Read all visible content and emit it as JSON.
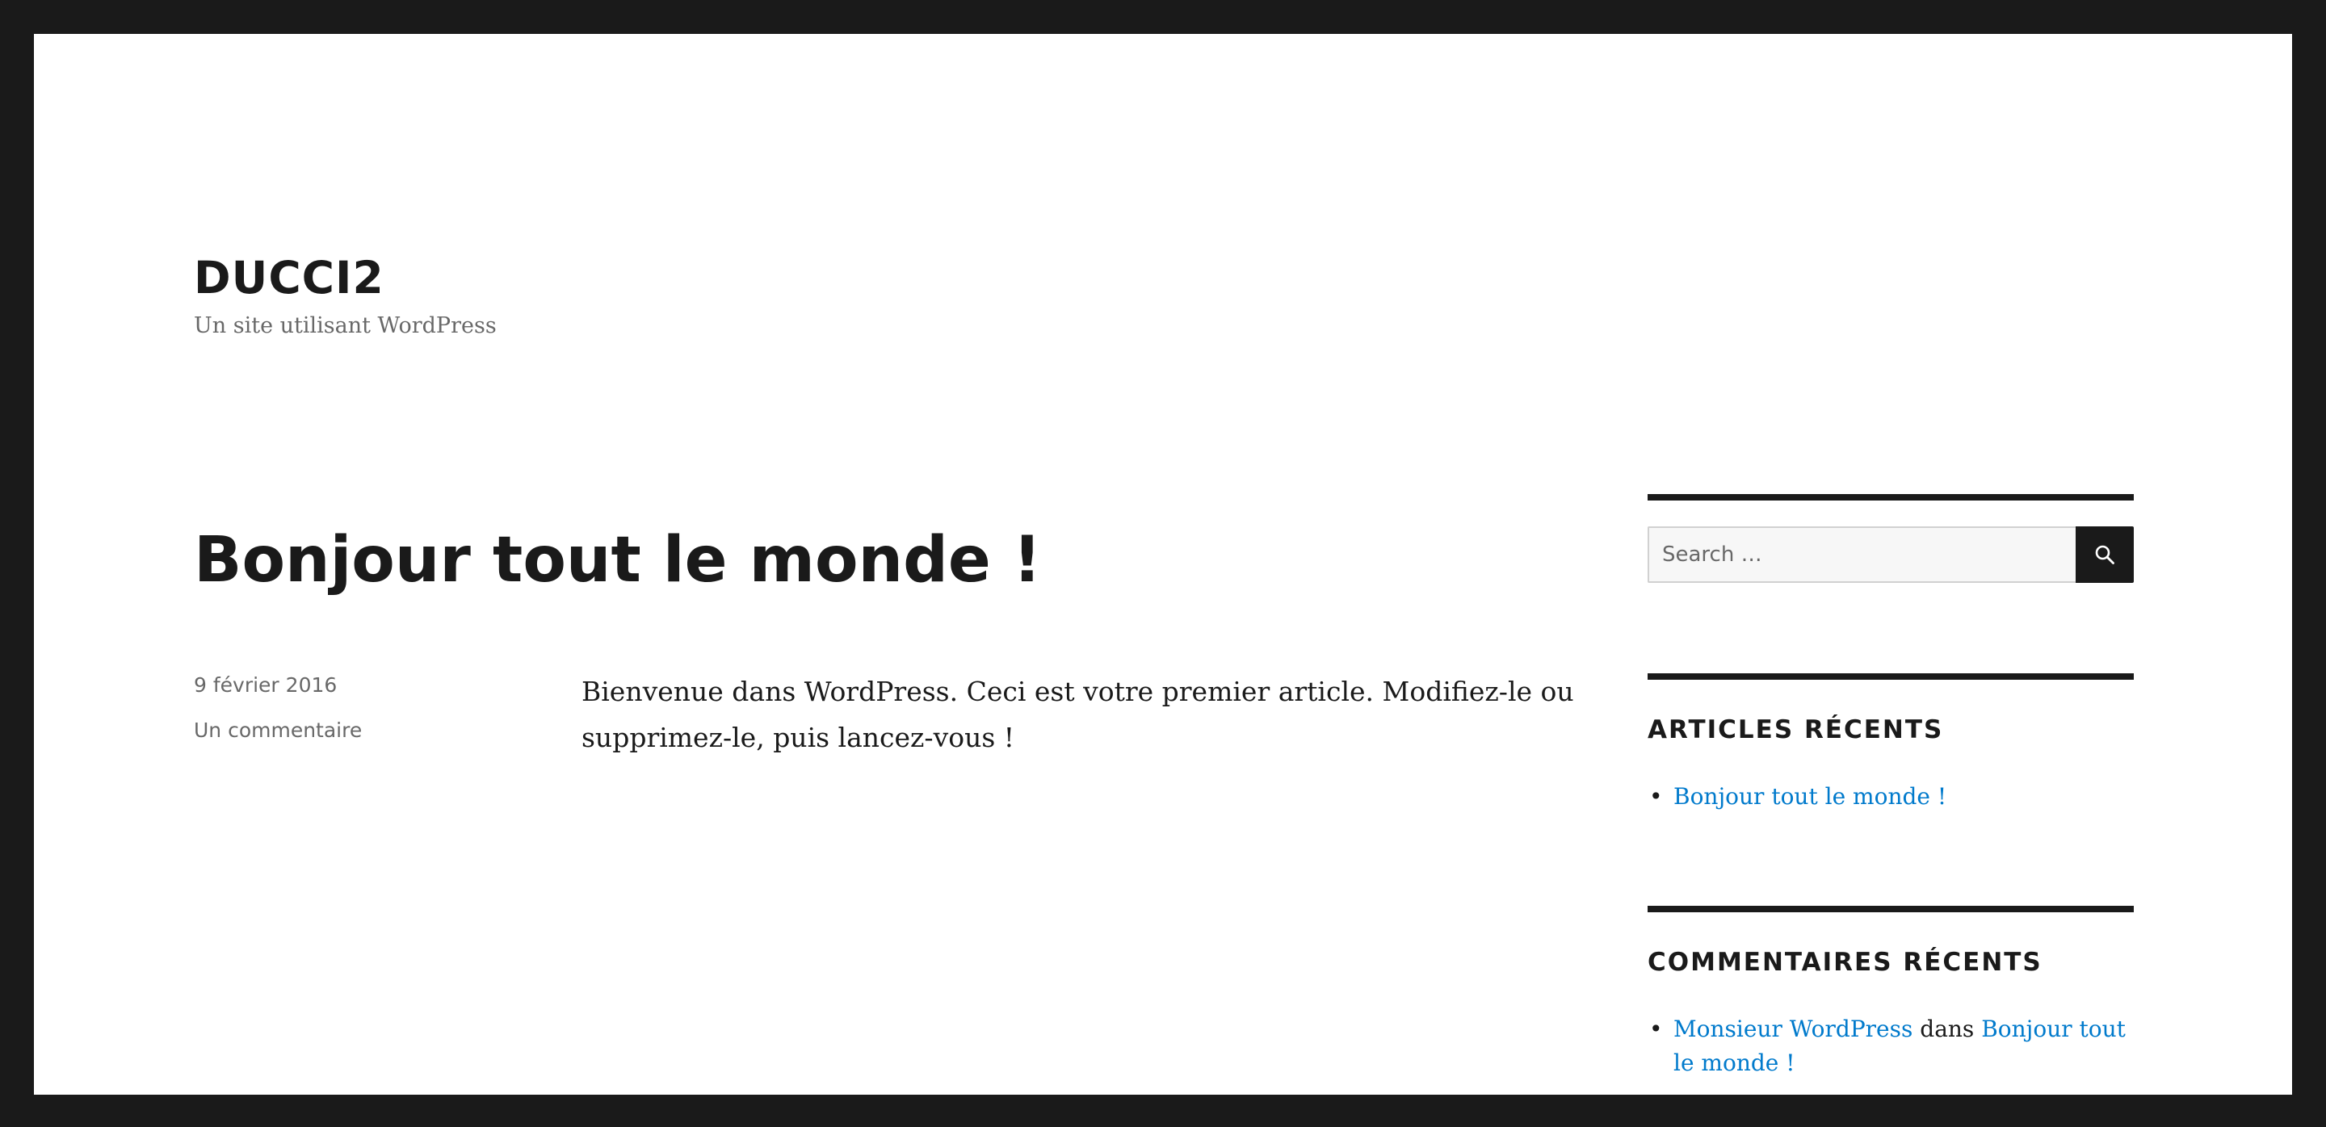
{
  "site": {
    "title": "DUCCI2",
    "description": "Un site utilisant WordPress"
  },
  "post": {
    "title": "Bonjour tout le monde !",
    "date": "9 février 2016",
    "comments_link": "Un commentaire",
    "content": "Bienvenue dans WordPress. Ceci est votre premier article. Modifiez-le ou supprimez-le, puis lancez-vous !"
  },
  "sidebar": {
    "search": {
      "placeholder": "Search …",
      "value": "",
      "button_icon": "search-icon"
    },
    "recent_posts": {
      "title": "ARTICLES RÉCENTS",
      "items": [
        {
          "label": "Bonjour tout le monde !"
        }
      ]
    },
    "recent_comments": {
      "title": "COMMENTAIRES RÉCENTS",
      "items": [
        {
          "author": "Monsieur WordPress",
          "connector": "dans",
          "post": "Bonjour tout le monde !"
        }
      ]
    }
  },
  "colors": {
    "frame": "#1a1a1a",
    "background": "#ffffff",
    "text": "#1a1a1a",
    "secondary_text": "#686868",
    "link": "#007acc"
  }
}
